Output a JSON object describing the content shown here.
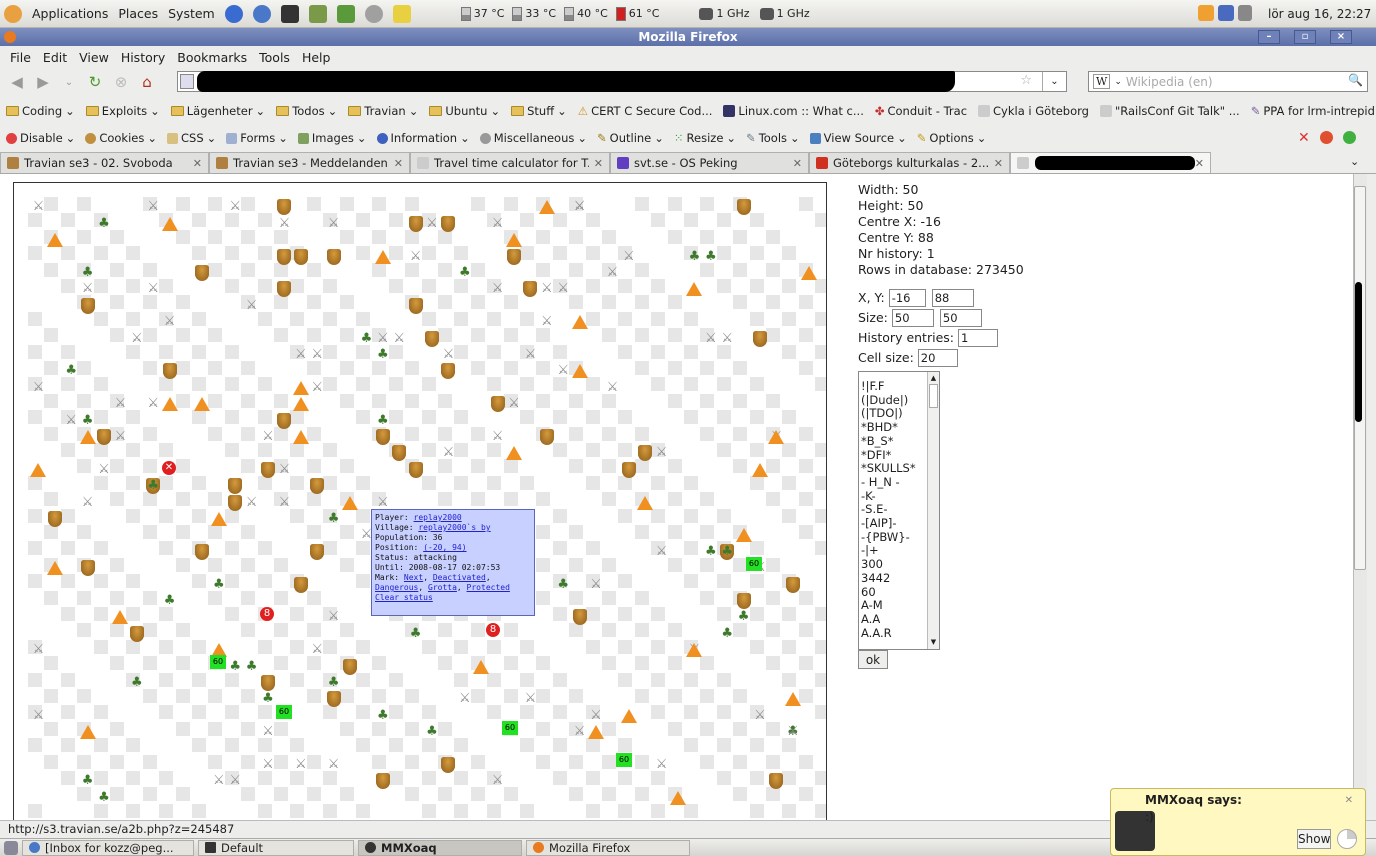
{
  "top_panel": {
    "applications": "Applications",
    "places": "Places",
    "system": "System",
    "temps": [
      "37 °C",
      "33 °C",
      "40 °C",
      "61 °C"
    ],
    "cpu1": "1 GHz",
    "cpu2": "1 GHz",
    "clock": "lör aug 16, 22:27"
  },
  "window": {
    "title": "Mozilla Firefox"
  },
  "menu": [
    "File",
    "Edit",
    "View",
    "History",
    "Bookmarks",
    "Tools",
    "Help"
  ],
  "search": {
    "engine": "W",
    "placeholder": "Wikipedia (en)"
  },
  "bookmarks": [
    "Coding",
    "Exploits",
    "Lägenheter",
    "Todos",
    "Travian",
    "Ubuntu",
    "Stuff",
    "CERT C Secure Cod...",
    "Linux.com :: What c...",
    "Conduit - Trac",
    "Cykla i Göteborg",
    "\"RailsConf Git Talk\" ...",
    "PPA for lrm-intrepid"
  ],
  "webdev": [
    "Disable",
    "Cookies",
    "CSS",
    "Forms",
    "Images",
    "Information",
    "Miscellaneous",
    "Outline",
    "Resize",
    "Tools",
    "View Source",
    "Options"
  ],
  "tabs": [
    "Travian se3 - 02. Svoboda",
    "Travian se3 - Meddelanden",
    "Travel time calculator for T...",
    "svt.se - OS Peking",
    "Göteborgs kulturkalas - 2..."
  ],
  "info": {
    "width": "Width: 50",
    "height": "Height: 50",
    "centre_x": "Centre X: -16",
    "centre_y": "Centre Y: 88",
    "nr_history": "Nr history: 1",
    "rows": "Rows in database: 273450"
  },
  "form": {
    "xy_label": "X, Y:",
    "x": "-16",
    "y": "88",
    "size_label": "Size:",
    "w": "50",
    "h": "50",
    "history_label": "History entries:",
    "history": "1",
    "cell_label": "Cell size:",
    "cell": "20",
    "ok": "ok"
  },
  "alliances": [
    "!|F.F",
    "(|Dude|)",
    "(|TDO|)",
    "*BHD*",
    "*B_S*",
    "*DFI*",
    "*SKULLS*",
    "- H_N -",
    "-K-",
    "-S.E-",
    "-[AIP]-",
    "-{PBW}-",
    "-|+",
    "300",
    "3442",
    "60",
    "A-M",
    "A.A",
    "A.A.R"
  ],
  "popup": {
    "player_label": "Player:",
    "player": "replay2000",
    "village_label": "Village:",
    "village": "replay2000`s by",
    "population": "Population: 36",
    "position_label": "Position:",
    "position": "(-20, 94)",
    "status": "Status: attacking",
    "until": "Until: 2008-08-17 02:07:53",
    "mark_label": "Mark:",
    "next": "Next",
    "deactivated": "Deactivated",
    "dangerous": "Dangerous",
    "grotta": "Grotta",
    "protected": "Protected",
    "clear": "Clear status"
  },
  "map_labels": {
    "green": "60",
    "red": "8"
  },
  "status_url": "http://s3.travian.se/a2b.php?z=245487",
  "taskbar": [
    "[Inbox for kozz@peg...",
    "Default",
    "MMXoaq",
    "Mozilla Firefox"
  ],
  "notification": {
    "title": "MMXoaq says:",
    "message": ":)",
    "show": "Show"
  }
}
